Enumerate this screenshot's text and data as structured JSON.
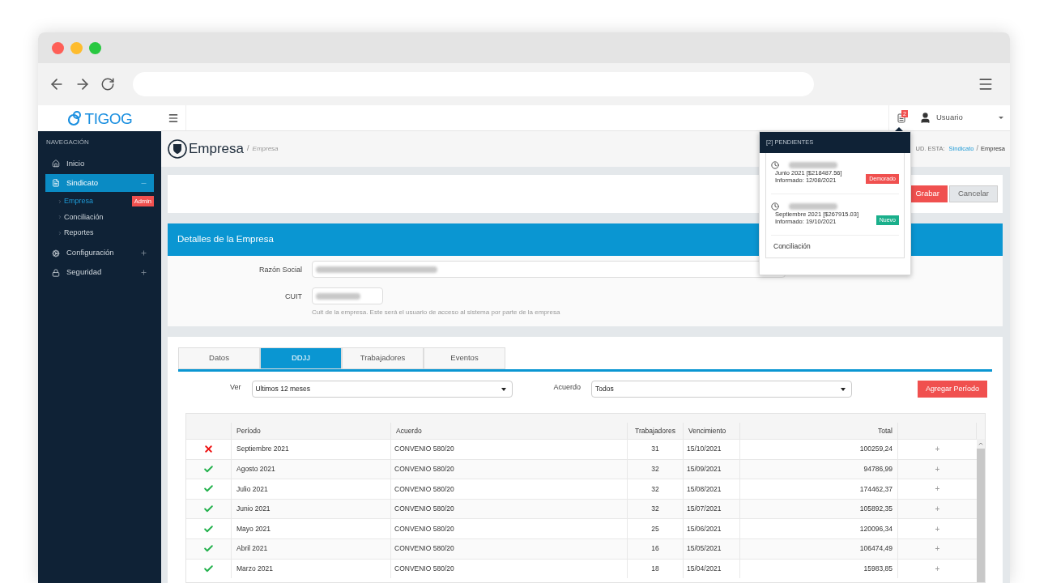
{
  "app": {
    "logo": "TIGOG"
  },
  "topbar": {
    "notification_count": "2",
    "user": "Usuario"
  },
  "sidebar": {
    "section": "NAVEGACIÓN",
    "items": [
      {
        "label": "Inicio",
        "selected": false
      },
      {
        "label": "Sindicato",
        "selected": true,
        "expanded": true,
        "children": [
          {
            "label": "Empresa",
            "selected": true,
            "badge": "Admin"
          },
          {
            "label": "Conciliación",
            "selected": false
          },
          {
            "label": "Reportes",
            "selected": false
          }
        ]
      },
      {
        "label": "Configuración",
        "selected": false,
        "expanded": false
      },
      {
        "label": "Seguridad",
        "selected": false,
        "expanded": false
      }
    ]
  },
  "page_header": {
    "title": "Empresa",
    "subtitle": "Empresa",
    "separator": "/",
    "breadcrumb": {
      "prefix": "UD. ESTA:",
      "separator": "/",
      "items": [
        {
          "label": "Sindicato",
          "kind": "link"
        },
        {
          "label": "Empresa",
          "kind": "current"
        }
      ]
    }
  },
  "actions": [
    {
      "label": "Grabar",
      "kind": "primary"
    },
    {
      "label": "Cancelar",
      "kind": "secondary"
    }
  ],
  "details": {
    "title": "Detalles de la Empresa",
    "fields": [
      {
        "label": "Razón Social"
      },
      {
        "label": "CUIT",
        "help": "Cuit de la empresa. Este será el usuario de acceso al sistema por parte de la empresa"
      }
    ]
  },
  "tabs": [
    {
      "label": "Datos",
      "selected": false
    },
    {
      "label": "DDJJ",
      "selected": true
    },
    {
      "label": "Trabajadores",
      "selected": false
    },
    {
      "label": "Eventos",
      "selected": false
    }
  ],
  "filters": [
    {
      "label": "Ver",
      "value": "Ultimos 12 meses"
    },
    {
      "label": "Acuerdo",
      "value": "Todos"
    }
  ],
  "add_button": "Agregar Período",
  "table": {
    "columns": [
      "Período",
      "Acuerdo",
      "Trabajadores",
      "Vencimiento",
      "Total"
    ],
    "rows": [
      {
        "kind": "error",
        "period": "Septiembre 2021",
        "agreement": "CONVENIO 580/20",
        "workers": "31",
        "due": "15/10/2021",
        "total": "100259,24",
        "action": "+"
      },
      {
        "kind": "ok",
        "period": "Agosto 2021",
        "agreement": "CONVENIO 580/20",
        "workers": "32",
        "due": "15/09/2021",
        "total": "94786,99",
        "action": "+"
      },
      {
        "kind": "ok",
        "period": "Julio 2021",
        "agreement": "CONVENIO 580/20",
        "workers": "32",
        "due": "15/08/2021",
        "total": "174462,37",
        "action": "+"
      },
      {
        "kind": "ok",
        "period": "Junio 2021",
        "agreement": "CONVENIO 580/20",
        "workers": "32",
        "due": "15/07/2021",
        "total": "105892,35",
        "action": "+"
      },
      {
        "kind": "ok",
        "period": "Mayo 2021",
        "agreement": "CONVENIO 580/20",
        "workers": "25",
        "due": "15/06/2021",
        "total": "120096,34",
        "action": "+"
      },
      {
        "kind": "ok",
        "period": "Abril 2021",
        "agreement": "CONVENIO 580/20",
        "workers": "16",
        "due": "15/05/2021",
        "total": "106474,49",
        "action": "+"
      },
      {
        "kind": "ok",
        "period": "Marzo 2021",
        "agreement": "CONVENIO 580/20",
        "workers": "18",
        "due": "15/04/2021",
        "total": "15983,85",
        "action": "+"
      }
    ]
  },
  "notifications": {
    "title": "[2] PENDIENTES",
    "items": [
      {
        "detail": "Junio 2021 [$218487.56]",
        "reported": "Informado: 12/08/2021",
        "tag": "Demorado",
        "color": "#f0504f"
      },
      {
        "detail": "Septiembre 2021 [$267915.03]",
        "reported": "Informado: 19/10/2021",
        "tag": "Nuevo",
        "color": "#1aaf8b"
      }
    ],
    "footer": "Conciliación"
  }
}
